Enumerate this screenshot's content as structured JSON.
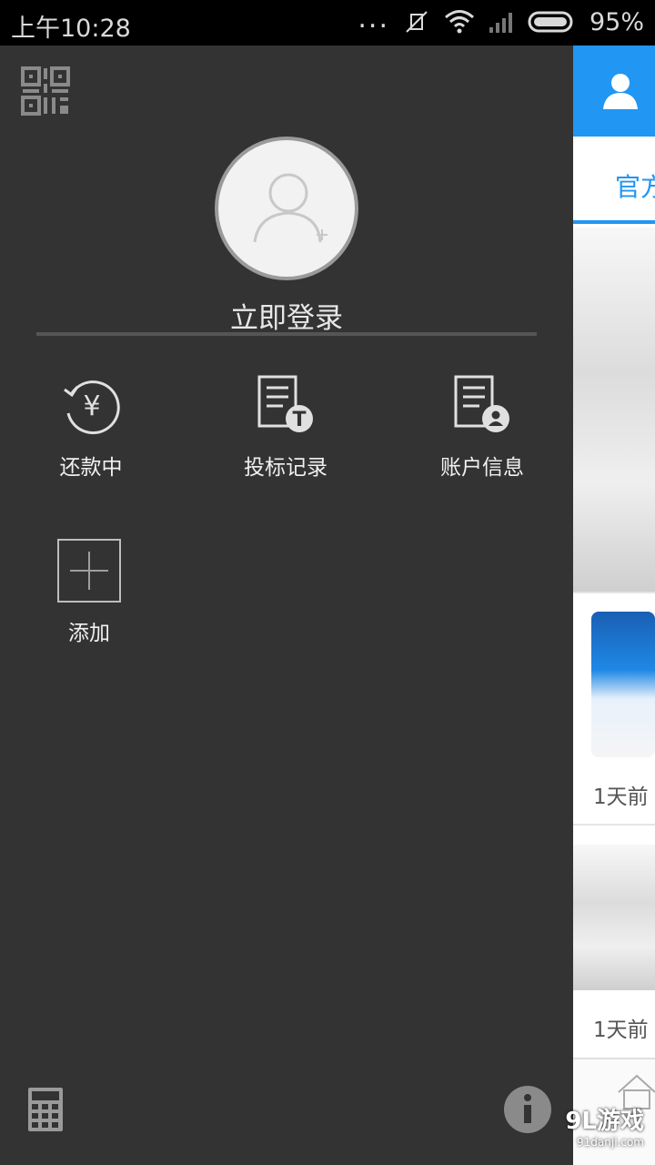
{
  "status_bar": {
    "time": "上午10:28",
    "dots": "...",
    "battery": "95%"
  },
  "drawer": {
    "login_label": "立即登录",
    "items": [
      {
        "label": "还款中",
        "icon": "repayment-yen-icon"
      },
      {
        "label": "投标记录",
        "icon": "bid-record-icon"
      },
      {
        "label": "账户信息",
        "icon": "account-info-icon"
      },
      {
        "label": "添加",
        "icon": "add-plus-icon"
      }
    ]
  },
  "main": {
    "tab_label": "官方",
    "list": [
      {
        "time_ago": "1天前"
      },
      {
        "time_ago": "1天前"
      }
    ]
  },
  "watermark": {
    "brand": "9L游戏",
    "site": "91danji.com"
  },
  "colors": {
    "drawer_bg": "#333333",
    "accent_blue": "#2196f3"
  }
}
